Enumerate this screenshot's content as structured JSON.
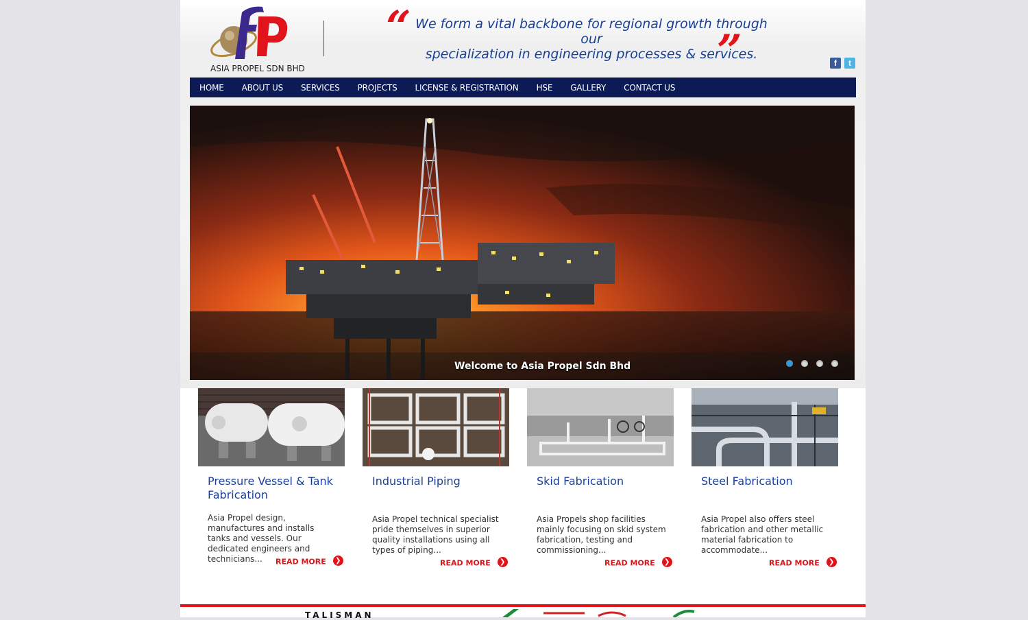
{
  "header": {
    "logo_text": "ASIA PROPEL SDN BHD",
    "quote_line1": "We form a vital backbone for regional growth through our",
    "quote_line2": "specialization in engineering processes & services.",
    "quote_open": "“",
    "quote_close": "”",
    "social": [
      {
        "label": "f",
        "icon": "facebook-icon"
      },
      {
        "label": "t",
        "icon": "twitter-icon"
      }
    ]
  },
  "nav": {
    "items": [
      "HOME",
      "ABOUT US",
      "SERVICES",
      "PROJECTS",
      "LICENSE & REGISTRATION",
      "HSE",
      "GALLERY",
      "CONTACT US"
    ]
  },
  "slider": {
    "caption": "Welcome to Asia Propel Sdn Bhd",
    "slide_count": 4,
    "active_slide": 1
  },
  "services": [
    {
      "title": "Pressure Vessel & Tank Fabrication",
      "description": "Asia Propel design, manufactures and installs tanks and vessels. Our dedicated engineers and technicians...",
      "read_more": "READ MORE"
    },
    {
      "title": "Industrial Piping",
      "description": "Asia Propel technical specialist pride themselves in superior quality installations using all types of piping...",
      "read_more": "READ MORE"
    },
    {
      "title": "Skid Fabrication",
      "description": "Asia Propels shop facilities mainly focusing on skid system fabrication, testing and commissioning...",
      "read_more": "READ MORE"
    },
    {
      "title": "Steel Fabrication",
      "description": "Asia Propel also offers steel fabrication and other metallic material fabrication to accommodate...",
      "read_more": "READ MORE"
    }
  ],
  "footer": {
    "partner_text": "TALISMAN"
  },
  "colors": {
    "nav_bg": "#0c1a56",
    "accent_red": "#e2141b",
    "title_blue": "#1a3f9a"
  }
}
